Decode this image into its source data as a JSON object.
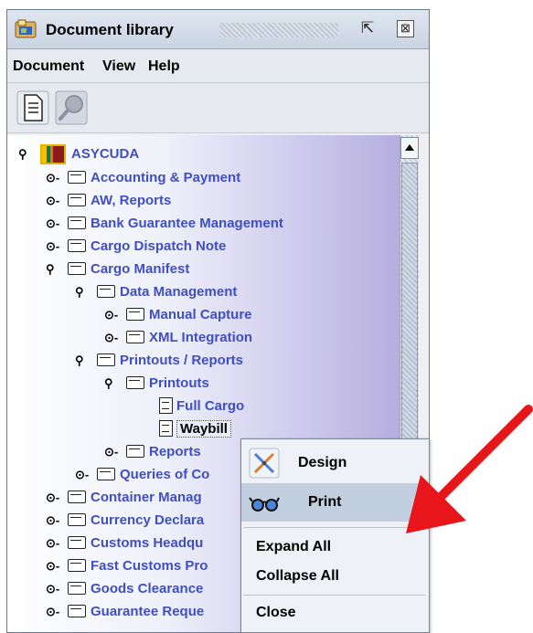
{
  "window": {
    "title": "Document library"
  },
  "menubar": [
    "Document",
    "View",
    "Help"
  ],
  "tree": [
    {
      "label": "ASYCUDA",
      "level": 0,
      "state": "expanded",
      "icon": "flag-icon"
    },
    {
      "label": "Accounting & Payment",
      "level": 1,
      "state": "collapsed",
      "icon": "folder-icon"
    },
    {
      "label": "AW, Reports",
      "level": 1,
      "state": "collapsed",
      "icon": "folder-icon"
    },
    {
      "label": "Bank Guarantee Management",
      "level": 1,
      "state": "collapsed",
      "icon": "folder-icon"
    },
    {
      "label": "Cargo Dispatch Note",
      "level": 1,
      "state": "collapsed",
      "icon": "folder-icon"
    },
    {
      "label": "Cargo Manifest",
      "level": 1,
      "state": "expanded",
      "icon": "folder-icon"
    },
    {
      "label": "Data Management",
      "level": 2,
      "state": "expanded",
      "icon": "folder-icon"
    },
    {
      "label": "Manual Capture",
      "level": 3,
      "state": "collapsed",
      "icon": "folder-icon"
    },
    {
      "label": "XML Integration",
      "level": 3,
      "state": "collapsed",
      "icon": "folder-icon"
    },
    {
      "label": "Printouts / Reports",
      "level": 2,
      "state": "expanded",
      "icon": "folder-icon"
    },
    {
      "label": "Printouts",
      "level": 3,
      "state": "expanded",
      "icon": "folder-icon"
    },
    {
      "label": "Full Cargo",
      "level": 4,
      "state": "leaf",
      "icon": "document-icon"
    },
    {
      "label": "Waybill",
      "level": 4,
      "state": "leaf",
      "icon": "document-icon",
      "selected": true
    },
    {
      "label": "Reports",
      "level": 3,
      "state": "collapsed",
      "icon": "folder-icon"
    },
    {
      "label": "Queries of Co",
      "level": 2,
      "state": "collapsed",
      "icon": "folder-icon"
    },
    {
      "label": "Container Manag",
      "level": 1,
      "state": "collapsed",
      "icon": "folder-icon"
    },
    {
      "label": "Currency Declara",
      "level": 1,
      "state": "collapsed",
      "icon": "folder-icon"
    },
    {
      "label": "Customs Headqu",
      "level": 1,
      "state": "collapsed",
      "icon": "folder-icon"
    },
    {
      "label": "Fast Customs Pro",
      "level": 1,
      "state": "collapsed",
      "icon": "folder-icon"
    },
    {
      "label": "Goods Clearance",
      "level": 1,
      "state": "collapsed",
      "icon": "folder-icon"
    },
    {
      "label": "Guarantee Reque",
      "level": 1,
      "state": "collapsed",
      "icon": "folder-icon"
    }
  ],
  "context_menu": {
    "design": "Design",
    "print": "Print",
    "expand_all": "Expand All",
    "collapse_all": "Collapse All",
    "close": "Close"
  },
  "colors": {
    "tree_text": "#3f4fc0",
    "annotation_arrow": "#e8161b"
  }
}
